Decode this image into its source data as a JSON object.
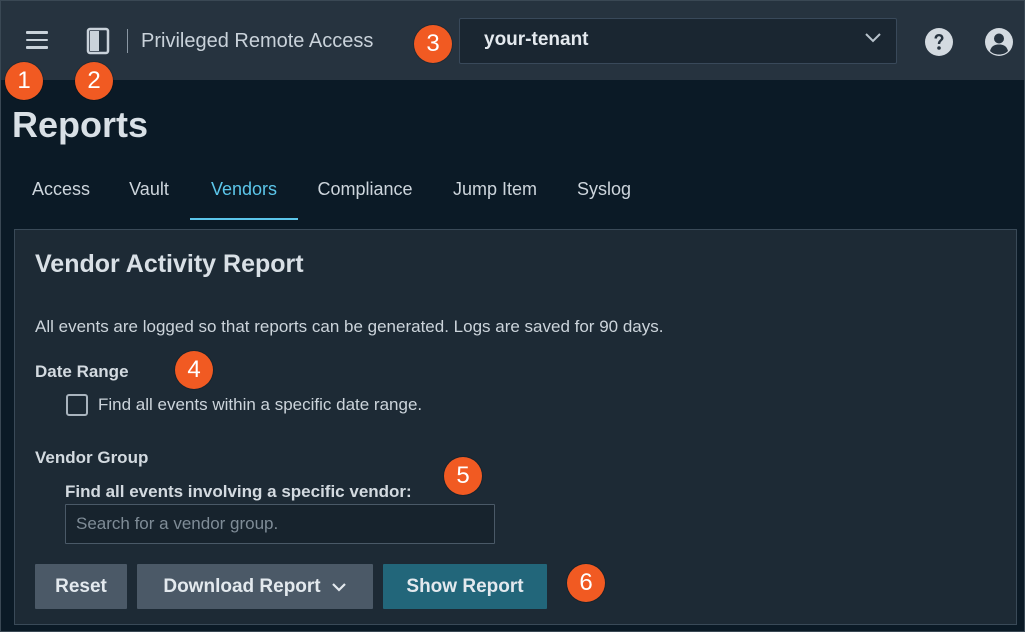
{
  "header": {
    "app_title": "Privileged Remote Access",
    "tenant_value": "your-tenant"
  },
  "badges": [
    "1",
    "2",
    "3",
    "4",
    "5",
    "6"
  ],
  "page": {
    "title": "Reports"
  },
  "tabs": [
    {
      "label": "Access",
      "active": false
    },
    {
      "label": "Vault",
      "active": false
    },
    {
      "label": "Vendors",
      "active": true
    },
    {
      "label": "Compliance",
      "active": false
    },
    {
      "label": "Jump Item",
      "active": false
    },
    {
      "label": "Syslog",
      "active": false
    }
  ],
  "report": {
    "title": "Vendor Activity Report",
    "description": "All events are logged so that reports can be generated. Logs are saved for 90 days.",
    "date_range_label": "Date Range",
    "date_range_checkbox": "Find all events within a specific date range.",
    "date_range_checked": false,
    "vendor_group_label": "Vendor Group",
    "vendor_field_label": "Find all events involving a specific vendor:",
    "vendor_placeholder": "Search for a vendor group.",
    "vendor_value": ""
  },
  "buttons": {
    "reset": "Reset",
    "download": "Download Report",
    "show": "Show Report"
  },
  "colors": {
    "badge": "#f15a22",
    "active_tab": "#5cc6ea",
    "primary_button": "#22667a",
    "secondary_button": "#4b5967",
    "header_bg": "#26333f",
    "page_bg": "#0b1a26"
  },
  "icons": [
    "hamburger-menu-icon",
    "panel-toggle-icon",
    "chevron-down-icon",
    "help-icon",
    "user-account-icon"
  ]
}
